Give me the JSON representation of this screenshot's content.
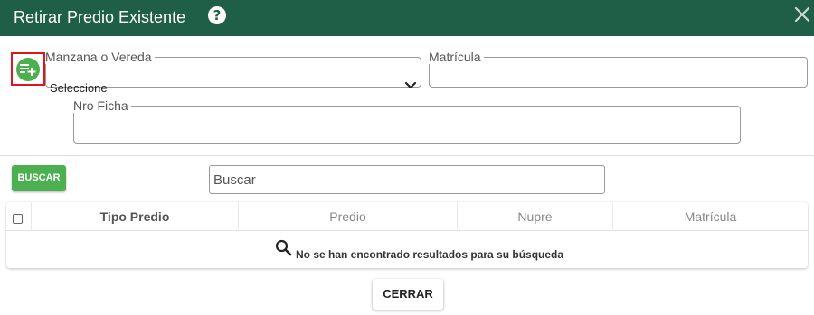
{
  "dialog": {
    "title": "Retirar Predio Existente",
    "help_glyph": "?",
    "header_color": "#1f5e47"
  },
  "form": {
    "manzana": {
      "label": "Manzana o Vereda",
      "selected": "Seleccione"
    },
    "matricula": {
      "label": "Matrícula",
      "value": ""
    },
    "ficha": {
      "label": "Nro Ficha",
      "value": ""
    }
  },
  "search": {
    "button_label": "BUSCAR",
    "placeholder": "Buscar"
  },
  "table": {
    "columns": [
      "Tipo Predio",
      "Predio",
      "Nupre",
      "Matrícula"
    ],
    "empty_message": "No se han encontrado resultados para su búsqueda"
  },
  "footer": {
    "close_label": "CERRAR"
  },
  "icons": {
    "add": "playlist-add-icon",
    "help": "help-icon",
    "close": "close-icon",
    "chevron": "chevron-down-icon",
    "search": "search-icon"
  },
  "colors": {
    "accent_green": "#4caf50",
    "highlight_red": "#e0141c"
  }
}
